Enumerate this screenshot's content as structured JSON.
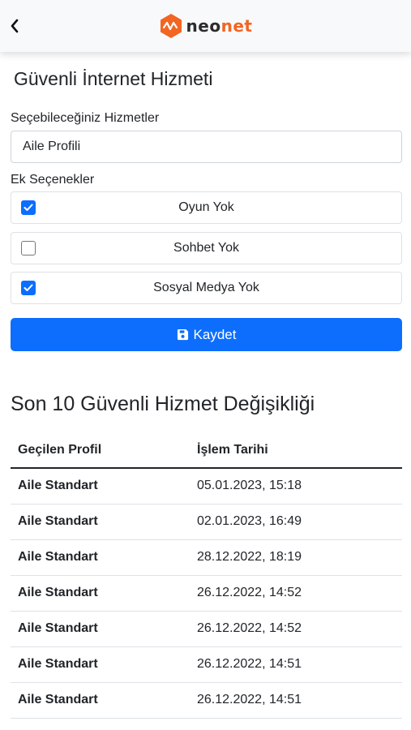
{
  "header": {
    "logo_text_part1": "neo",
    "logo_text_part2": "net",
    "brand_color": "#f26522"
  },
  "page": {
    "title": "Güvenli İnternet Hizmeti"
  },
  "form": {
    "services_label": "Seçebileceğiniz Hizmetler",
    "selected_service": "Aile Profili",
    "extras_label": "Ek Seçenekler",
    "options": [
      {
        "label": "Oyun Yok",
        "checked": true
      },
      {
        "label": "Sohbet Yok",
        "checked": false
      },
      {
        "label": "Sosyal Medya Yok",
        "checked": true
      }
    ],
    "save_label": "Kaydet",
    "accent_color": "#0d6efd"
  },
  "history": {
    "title": "Son 10 Güvenli Hizmet Değişikliği",
    "columns": [
      "Geçilen Profil",
      "İşlem Tarihi"
    ],
    "rows": [
      [
        "Aile Standart",
        "05.01.2023, 15:18"
      ],
      [
        "Aile Standart",
        "02.01.2023, 16:49"
      ],
      [
        "Aile Standart",
        "28.12.2022, 18:19"
      ],
      [
        "Aile Standart",
        "26.12.2022, 14:52"
      ],
      [
        "Aile Standart",
        "26.12.2022, 14:52"
      ],
      [
        "Aile Standart",
        "26.12.2022, 14:51"
      ],
      [
        "Aile Standart",
        "26.12.2022, 14:51"
      ]
    ]
  }
}
